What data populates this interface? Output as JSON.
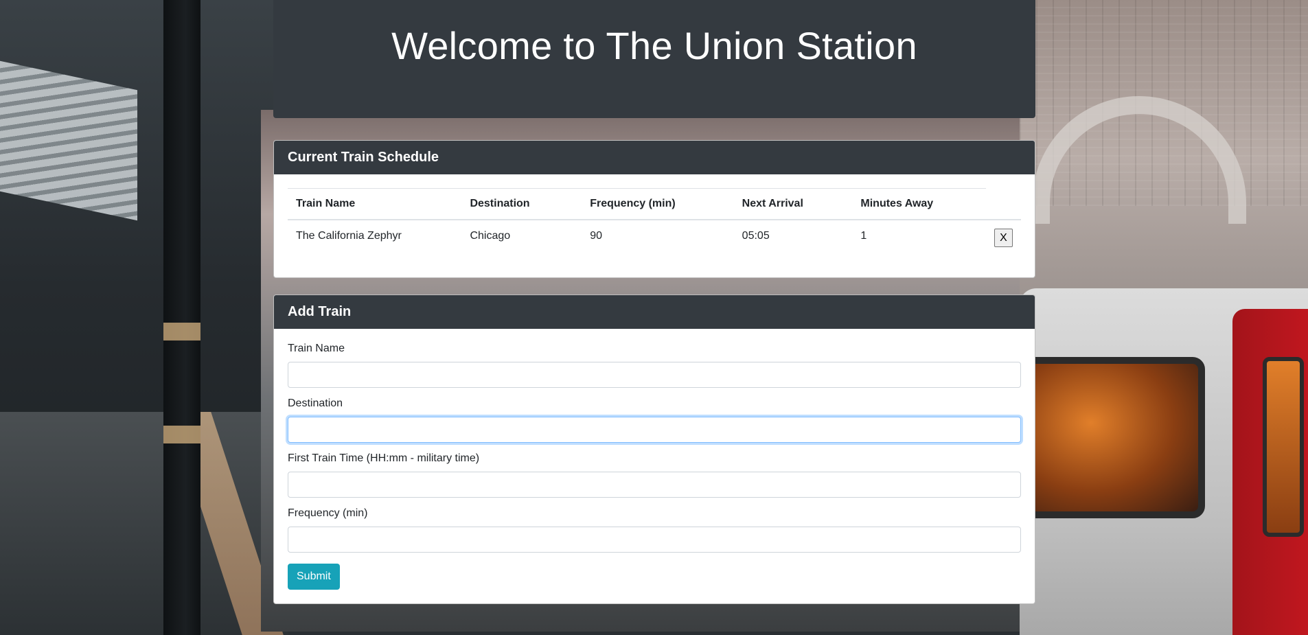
{
  "jumbotron": {
    "title": "Welcome to The Union Station"
  },
  "schedule": {
    "header": "Current Train Schedule",
    "columns": [
      "Train Name",
      "Destination",
      "Frequency (min)",
      "Next Arrival",
      "Minutes Away"
    ],
    "rows": [
      {
        "train_name": "The California Zephyr",
        "destination": "Chicago",
        "frequency": "90",
        "next_arrival": "05:05",
        "minutes_away": "1",
        "remove_label": "X"
      }
    ]
  },
  "add_train": {
    "header": "Add Train",
    "fields": [
      {
        "label": "Train Name",
        "value": ""
      },
      {
        "label": "Destination",
        "value": ""
      },
      {
        "label": "First Train Time (HH:mm - military time)",
        "value": ""
      },
      {
        "label": "Frequency (min)",
        "value": ""
      }
    ],
    "submit_label": "Submit"
  },
  "colors": {
    "header_bg": "#343a40",
    "submit_bg": "#17a2b8",
    "focus_border": "#80bdff"
  }
}
